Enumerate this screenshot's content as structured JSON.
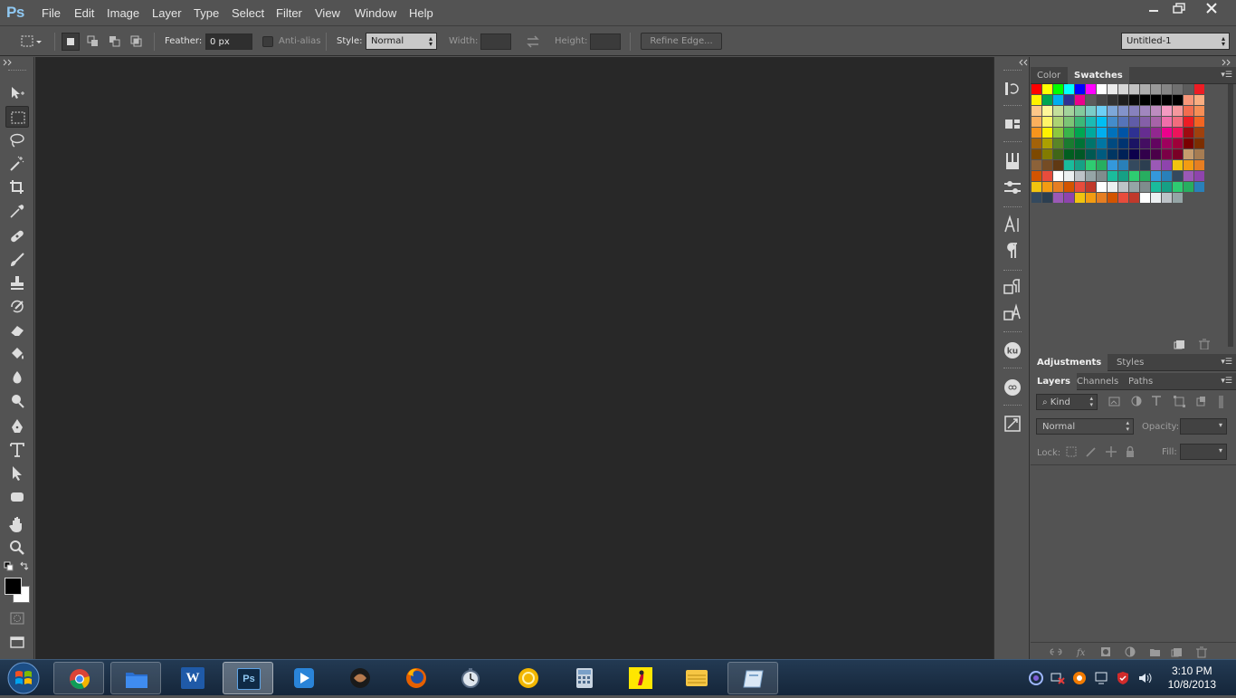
{
  "app": {
    "logo": "Ps",
    "menu": [
      "File",
      "Edit",
      "Image",
      "Layer",
      "Type",
      "Select",
      "Filter",
      "View",
      "Window",
      "Help"
    ]
  },
  "options_bar": {
    "feather_label": "Feather:",
    "feather_value": "0 px",
    "antialias_label": "Anti-alias",
    "style_label": "Style:",
    "style_value": "Normal",
    "width_label": "Width:",
    "height_label": "Height:",
    "refine_edge_label": "Refine Edge...",
    "workspace_value": "Untitled-1"
  },
  "tools": [
    {
      "name": "move-tool",
      "icon": "move-icon"
    },
    {
      "name": "marquee-tool",
      "icon": "marquee-icon",
      "active": true
    },
    {
      "name": "lasso-tool",
      "icon": "lasso-icon"
    },
    {
      "name": "magic-wand-tool",
      "icon": "magic-wand-icon"
    },
    {
      "name": "crop-tool",
      "icon": "crop-icon"
    },
    {
      "name": "eyedropper-tool",
      "icon": "eyedropper-icon"
    },
    {
      "name": "healing-brush-tool",
      "icon": "bandage-icon"
    },
    {
      "name": "brush-tool",
      "icon": "brush-icon"
    },
    {
      "name": "clone-stamp-tool",
      "icon": "stamp-icon"
    },
    {
      "name": "history-brush-tool",
      "icon": "history-brush-icon"
    },
    {
      "name": "eraser-tool",
      "icon": "eraser-icon"
    },
    {
      "name": "paint-bucket-tool",
      "icon": "paint-bucket-icon"
    },
    {
      "name": "blur-tool",
      "icon": "drop-icon"
    },
    {
      "name": "dodge-tool",
      "icon": "dodge-icon"
    },
    {
      "name": "pen-tool",
      "icon": "pen-icon"
    },
    {
      "name": "type-tool",
      "icon": "type-icon"
    },
    {
      "name": "path-selection-tool",
      "icon": "arrow-icon"
    },
    {
      "name": "shape-tool",
      "icon": "rounded-rect-icon"
    },
    {
      "name": "hand-tool",
      "icon": "hand-icon"
    },
    {
      "name": "zoom-tool",
      "icon": "magnifier-icon"
    }
  ],
  "colors": {
    "foreground": "#000000",
    "background": "#ffffff"
  },
  "panels": {
    "top_tabs": [
      "Color",
      "Swatches"
    ],
    "top_active": "Swatches",
    "adjust_tabs": [
      "Adjustments",
      "Styles"
    ],
    "adjust_active": "Adjustments",
    "layer_tabs": [
      "Layers",
      "Channels",
      "Paths"
    ],
    "layer_active": "Layers",
    "kind_label": "Kind",
    "blend_mode": "Normal",
    "opacity_label": "Opacity:",
    "lock_label": "Lock:",
    "fill_label": "Fill:"
  },
  "swatch_rows": [
    [
      "#ff0000",
      "#ffff00",
      "#00ff00",
      "#00ffff",
      "#0000ff",
      "#ff00ff",
      "#ffffff",
      "#ebebeb",
      "#d6d6d6",
      "#c2c2c2",
      "#adadad",
      "#999999",
      "#858585",
      "#707070",
      "#5c5c5c",
      "#ed1c24"
    ],
    [
      "#fff200",
      "#00a651",
      "#00aeef",
      "#2e3192",
      "#ec008c",
      "#5c5c5c",
      "#474747",
      "#333333",
      "#1f1f1f",
      "#0a0a0a",
      "#000000",
      "#000000",
      "#000000",
      "#000000",
      "#f69679",
      "#f9ad81"
    ],
    [
      "#fdc689",
      "#fff799",
      "#c4df9b",
      "#a3d39c",
      "#82ca9c",
      "#7accc8",
      "#6dcff6",
      "#7da7d9",
      "#8393ca",
      "#8781bd",
      "#a186be",
      "#bd8cbf",
      "#f49ac1",
      "#f5989d",
      "#f26c4f",
      "#f68e56"
    ],
    [
      "#fbaf5d",
      "#fff568",
      "#acd373",
      "#7cc576",
      "#3cb878",
      "#1cbbb4",
      "#00bff3",
      "#448ccb",
      "#5674b9",
      "#605ca8",
      "#855fa8",
      "#a763a8",
      "#f06eaa",
      "#f26d7d",
      "#ed1c24",
      "#f26522"
    ],
    [
      "#f7941d",
      "#fff200",
      "#8dc73f",
      "#39b54a",
      "#00a651",
      "#00a99d",
      "#00aeef",
      "#0072bc",
      "#0054a6",
      "#2e3192",
      "#662d91",
      "#92278f",
      "#ec008c",
      "#ed145b",
      "#9e0b0f",
      "#a0410d"
    ],
    [
      "#a36209",
      "#aba000",
      "#598527",
      "#197b30",
      "#007236",
      "#00746b",
      "#0076a3",
      "#004a80",
      "#003471",
      "#1b1464",
      "#440e62",
      "#630460",
      "#9e005d",
      "#9e0039",
      "#790000",
      "#7b2e00"
    ],
    [
      "#7d4900",
      "#827b00",
      "#406618",
      "#005e20",
      "#005826",
      "#005952",
      "#005b7f",
      "#003663",
      "#002157",
      "#0d004c",
      "#32004b",
      "#4b0049",
      "#7b0046",
      "#7a0026",
      "#c69c6d",
      "#a67c52"
    ],
    [
      "#8c6239",
      "#754c24",
      "#603913",
      "#1abc9c",
      "#16a085",
      "#2ecc71",
      "#27ae60",
      "#3498db",
      "#2980b9",
      "#34495e",
      "#2c3e50",
      "#9b59b6",
      "#8e44ad",
      "#f1c40f",
      "#f39c12",
      "#e67e22"
    ],
    [
      "#d35400",
      "#e74c3c",
      "#ffffff",
      "#ecf0f1",
      "#bdc3c7",
      "#95a5a6",
      "#7f8c8d",
      "#1abc9c",
      "#16a085",
      "#2ecc71",
      "#27ae60",
      "#3498db",
      "#2980b9",
      "#34495e",
      "#9b59b6",
      "#8e44ad"
    ],
    [
      "#f1c40f",
      "#f39c12",
      "#e67e22",
      "#d35400",
      "#e74c3c",
      "#c0392b",
      "#ffffff",
      "#ecf0f1",
      "#bdc3c7",
      "#95a5a6",
      "#7f8c8d",
      "#1abc9c",
      "#16a085",
      "#2ecc71",
      "#27ae60",
      "#2980b9"
    ],
    [
      "#34495e",
      "#2c3e50",
      "#9b59b6",
      "#8e44ad",
      "#f1c40f",
      "#f39c12",
      "#e67e22",
      "#d35400",
      "#e74c3c",
      "#c0392b",
      "#ffffff",
      "#ecf0f1",
      "#bdc3c7",
      "#95a5a6"
    ]
  ],
  "taskbar": {
    "time": "3:10 PM",
    "date": "10/8/2013",
    "apps": [
      {
        "name": "chrome",
        "icon": "chrome-icon",
        "state": "open"
      },
      {
        "name": "explorer",
        "icon": "folder-icon",
        "state": "open"
      },
      {
        "name": "word",
        "icon": "word-icon",
        "state": "normal"
      },
      {
        "name": "photoshop",
        "icon": "photoshop-icon",
        "state": "active"
      },
      {
        "name": "video",
        "icon": "play-icon",
        "state": "normal"
      },
      {
        "name": "app-brown",
        "icon": "brown-ball-icon",
        "state": "normal"
      },
      {
        "name": "firefox",
        "icon": "firefox-icon",
        "state": "normal"
      },
      {
        "name": "clock-app",
        "icon": "stopwatch-icon",
        "state": "normal"
      },
      {
        "name": "gold-app",
        "icon": "gold-circle-icon",
        "state": "normal"
      },
      {
        "name": "calculator",
        "icon": "calculator-icon",
        "state": "normal"
      },
      {
        "name": "yellow-app",
        "icon": "yellow-card-icon",
        "state": "normal"
      },
      {
        "name": "notes",
        "icon": "notes-icon",
        "state": "normal"
      },
      {
        "name": "paint",
        "icon": "paint-icon",
        "state": "open"
      }
    ],
    "word_icon_text": "W",
    "ps_icon_text": "Ps"
  }
}
